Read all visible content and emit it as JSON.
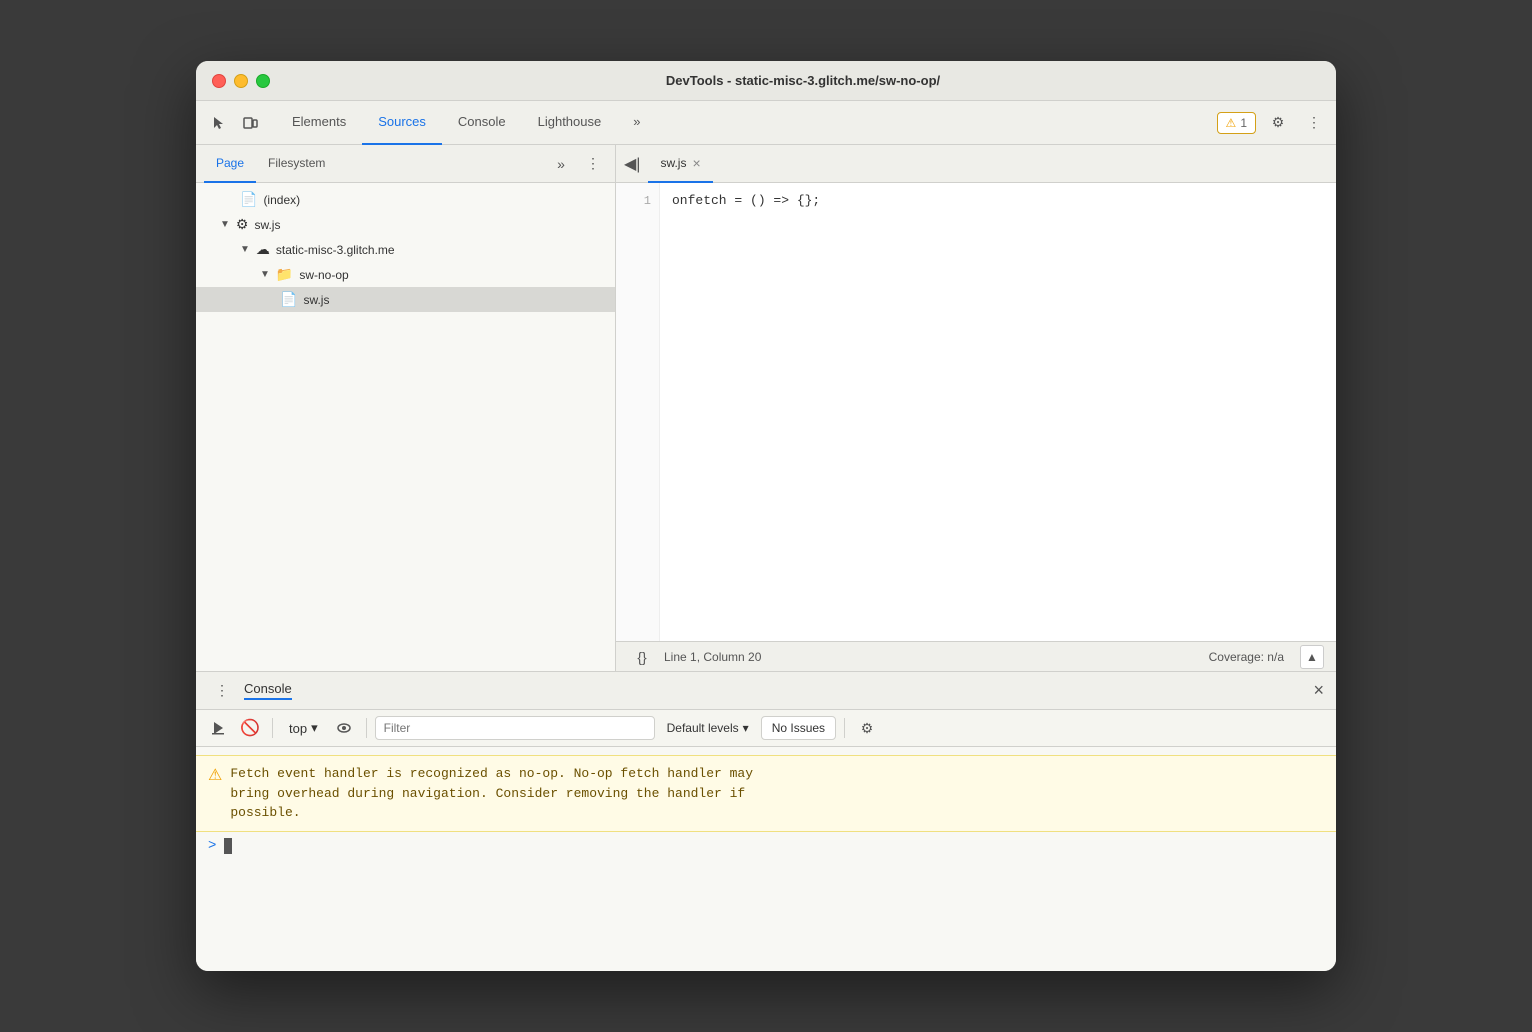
{
  "window": {
    "title": "DevTools - static-misc-3.glitch.me/sw-no-op/"
  },
  "top_tabs": {
    "tabs": [
      {
        "id": "elements",
        "label": "Elements",
        "active": false
      },
      {
        "id": "sources",
        "label": "Sources",
        "active": true
      },
      {
        "id": "console",
        "label": "Console",
        "active": false
      },
      {
        "id": "lighthouse",
        "label": "Lighthouse",
        "active": false
      }
    ],
    "more_label": "»",
    "warning_count": "1",
    "gear_label": "⚙",
    "more_vert_label": "⋮"
  },
  "left_panel": {
    "sub_tabs": [
      {
        "id": "page",
        "label": "Page",
        "active": true
      },
      {
        "id": "filesystem",
        "label": "Filesystem",
        "active": false
      }
    ],
    "more_label": "»",
    "menu_label": "⋮",
    "tree": [
      {
        "id": "index",
        "indent": 2,
        "label": "(index)",
        "type": "doc",
        "arrow": false
      },
      {
        "id": "sw-js-root",
        "indent": 1,
        "label": "sw.js",
        "type": "gear-js",
        "arrow": "▼",
        "expanded": true
      },
      {
        "id": "domain",
        "indent": 2,
        "label": "static-misc-3.glitch.me",
        "type": "cloud",
        "arrow": "▼",
        "expanded": true
      },
      {
        "id": "sw-no-op-folder",
        "indent": 3,
        "label": "sw-no-op",
        "type": "folder",
        "arrow": "▼",
        "expanded": true
      },
      {
        "id": "sw-js-file",
        "indent": 4,
        "label": "sw.js",
        "type": "js",
        "arrow": false,
        "selected": true
      }
    ]
  },
  "editor": {
    "tab_label": "sw.js",
    "close_label": "×",
    "code_lines": [
      {
        "number": "1",
        "code": "onfetch = () => {};"
      }
    ],
    "status": {
      "format_label": "{}",
      "position": "Line 1, Column 20",
      "coverage": "Coverage: n/a"
    }
  },
  "console_panel": {
    "title": "Console",
    "close_label": "×",
    "toolbar": {
      "play_label": "▶",
      "block_label": "🚫",
      "top_label": "top",
      "arrow_label": "▾",
      "eye_label": "👁",
      "filter_placeholder": "Filter",
      "default_levels_label": "Default levels",
      "levels_arrow": "▾",
      "issues_label": "No Issues",
      "gear_label": "⚙"
    },
    "messages": [
      {
        "type": "warning",
        "text": "Fetch event handler is recognized as no-op. No-op fetch handler may\nbring overhead during navigation. Consider removing the handler if\npossible."
      }
    ],
    "prompt": ">"
  },
  "colors": {
    "active_tab_blue": "#1a73e8",
    "warning_yellow_bg": "#fffbe6",
    "warning_yellow_border": "#f0e080",
    "warning_icon": "#f0a000",
    "warning_text": "#6b5000",
    "selected_row": "#d8d8d4"
  }
}
